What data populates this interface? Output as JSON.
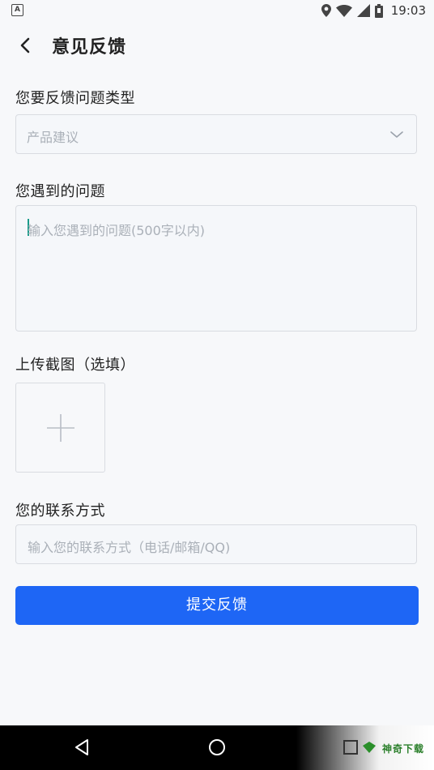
{
  "statusbar": {
    "app_icon": "A",
    "time": "19:03",
    "icons": [
      "location-icon",
      "wifi-icon",
      "signal-icon",
      "battery-icon"
    ]
  },
  "header": {
    "title": "意见反馈",
    "back_icon": "chevron-left-icon"
  },
  "form": {
    "type_label": "您要反馈问题类型",
    "type_value": "产品建议",
    "problem_label": "您遇到的问题",
    "problem_placeholder": "输入您遇到的问题(500字以内)",
    "screenshot_label": "上传截图（选填）",
    "contact_label": "您的联系方式",
    "contact_placeholder": "输入您的联系方式（电话/邮箱/QQ)",
    "submit_label": "提交反馈"
  },
  "navbar": {
    "buttons": [
      "back-triangle-icon",
      "home-circle-icon",
      "recents-square-icon"
    ]
  },
  "watermark": {
    "text": "神奇下载"
  },
  "colors": {
    "accent": "#1e66f5",
    "background": "#f7f8fa",
    "border": "#d9dce1",
    "placeholder": "#aab0b8"
  }
}
